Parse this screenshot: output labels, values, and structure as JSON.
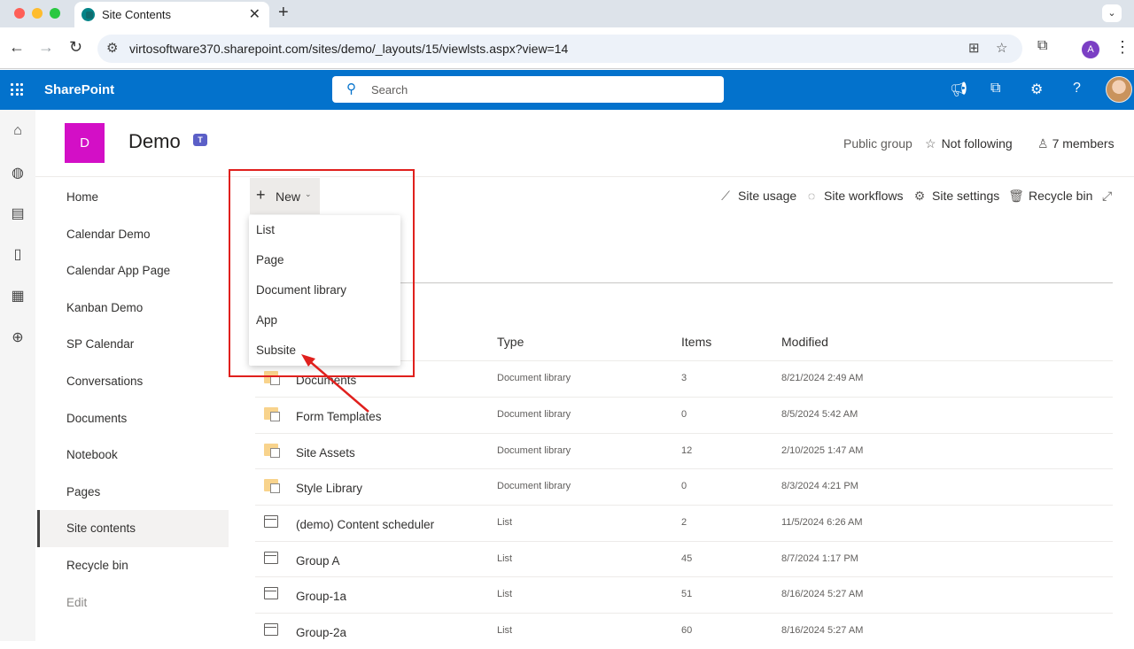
{
  "browser": {
    "tab_title": "Site Contents",
    "tab_close": "✕",
    "new_tab": "+",
    "tab_menu": "⌄",
    "url": "virtosoftware370.sharepoint.com/sites/demo/_layouts/15/viewlsts.aspx?view=14",
    "profile_initial": "A"
  },
  "suitebar": {
    "brand": "SharePoint",
    "search_placeholder": "Search"
  },
  "site": {
    "logo_letter": "D",
    "title": "Demo",
    "teams_letter": "T",
    "public_group": "Public group",
    "follow_label": "Not following",
    "members_label": "7 members"
  },
  "leftnav": {
    "items": [
      {
        "label": "Home"
      },
      {
        "label": "Calendar Demo"
      },
      {
        "label": "Calendar App Page"
      },
      {
        "label": "Kanban Demo"
      },
      {
        "label": "SP Calendar"
      },
      {
        "label": "Conversations"
      },
      {
        "label": "Documents"
      },
      {
        "label": "Notebook"
      },
      {
        "label": "Pages"
      },
      {
        "label": "Site contents"
      },
      {
        "label": "Recycle bin"
      }
    ],
    "edit_label": "Edit"
  },
  "commandbar": {
    "new_label": "New",
    "site_usage": "Site usage",
    "site_workflows": "Site workflows",
    "site_settings": "Site settings",
    "recycle_bin": "Recycle bin"
  },
  "new_menu": {
    "items": [
      "List",
      "Page",
      "Document library",
      "App",
      "Subsite"
    ]
  },
  "table": {
    "columns": {
      "type": "Type",
      "items": "Items",
      "modified": "Modified"
    },
    "rows": [
      {
        "name": "Documents",
        "type": "Document library",
        "items": "3",
        "modified": "8/21/2024 2:49 AM",
        "icon": "library"
      },
      {
        "name": "Form Templates",
        "type": "Document library",
        "items": "0",
        "modified": "8/5/2024 5:42 AM",
        "icon": "library"
      },
      {
        "name": "Site Assets",
        "type": "Document library",
        "items": "12",
        "modified": "2/10/2025 1:47 AM",
        "icon": "library"
      },
      {
        "name": "Style Library",
        "type": "Document library",
        "items": "0",
        "modified": "8/3/2024 4:21 PM",
        "icon": "library"
      },
      {
        "name": "(demo) Content scheduler",
        "type": "List",
        "items": "2",
        "modified": "11/5/2024 6:26 AM",
        "icon": "list"
      },
      {
        "name": "Group A",
        "type": "List",
        "items": "45",
        "modified": "8/7/2024 1:17 PM",
        "icon": "list"
      },
      {
        "name": "Group-1a",
        "type": "List",
        "items": "51",
        "modified": "8/16/2024 5:27 AM",
        "icon": "list"
      },
      {
        "name": "Group-2a",
        "type": "List",
        "items": "60",
        "modified": "8/16/2024 5:27 AM",
        "icon": "list"
      }
    ]
  },
  "colors": {
    "suitebar": "#0372cc",
    "site_logo": "#d30fc6",
    "annotation": "#e0201d"
  }
}
